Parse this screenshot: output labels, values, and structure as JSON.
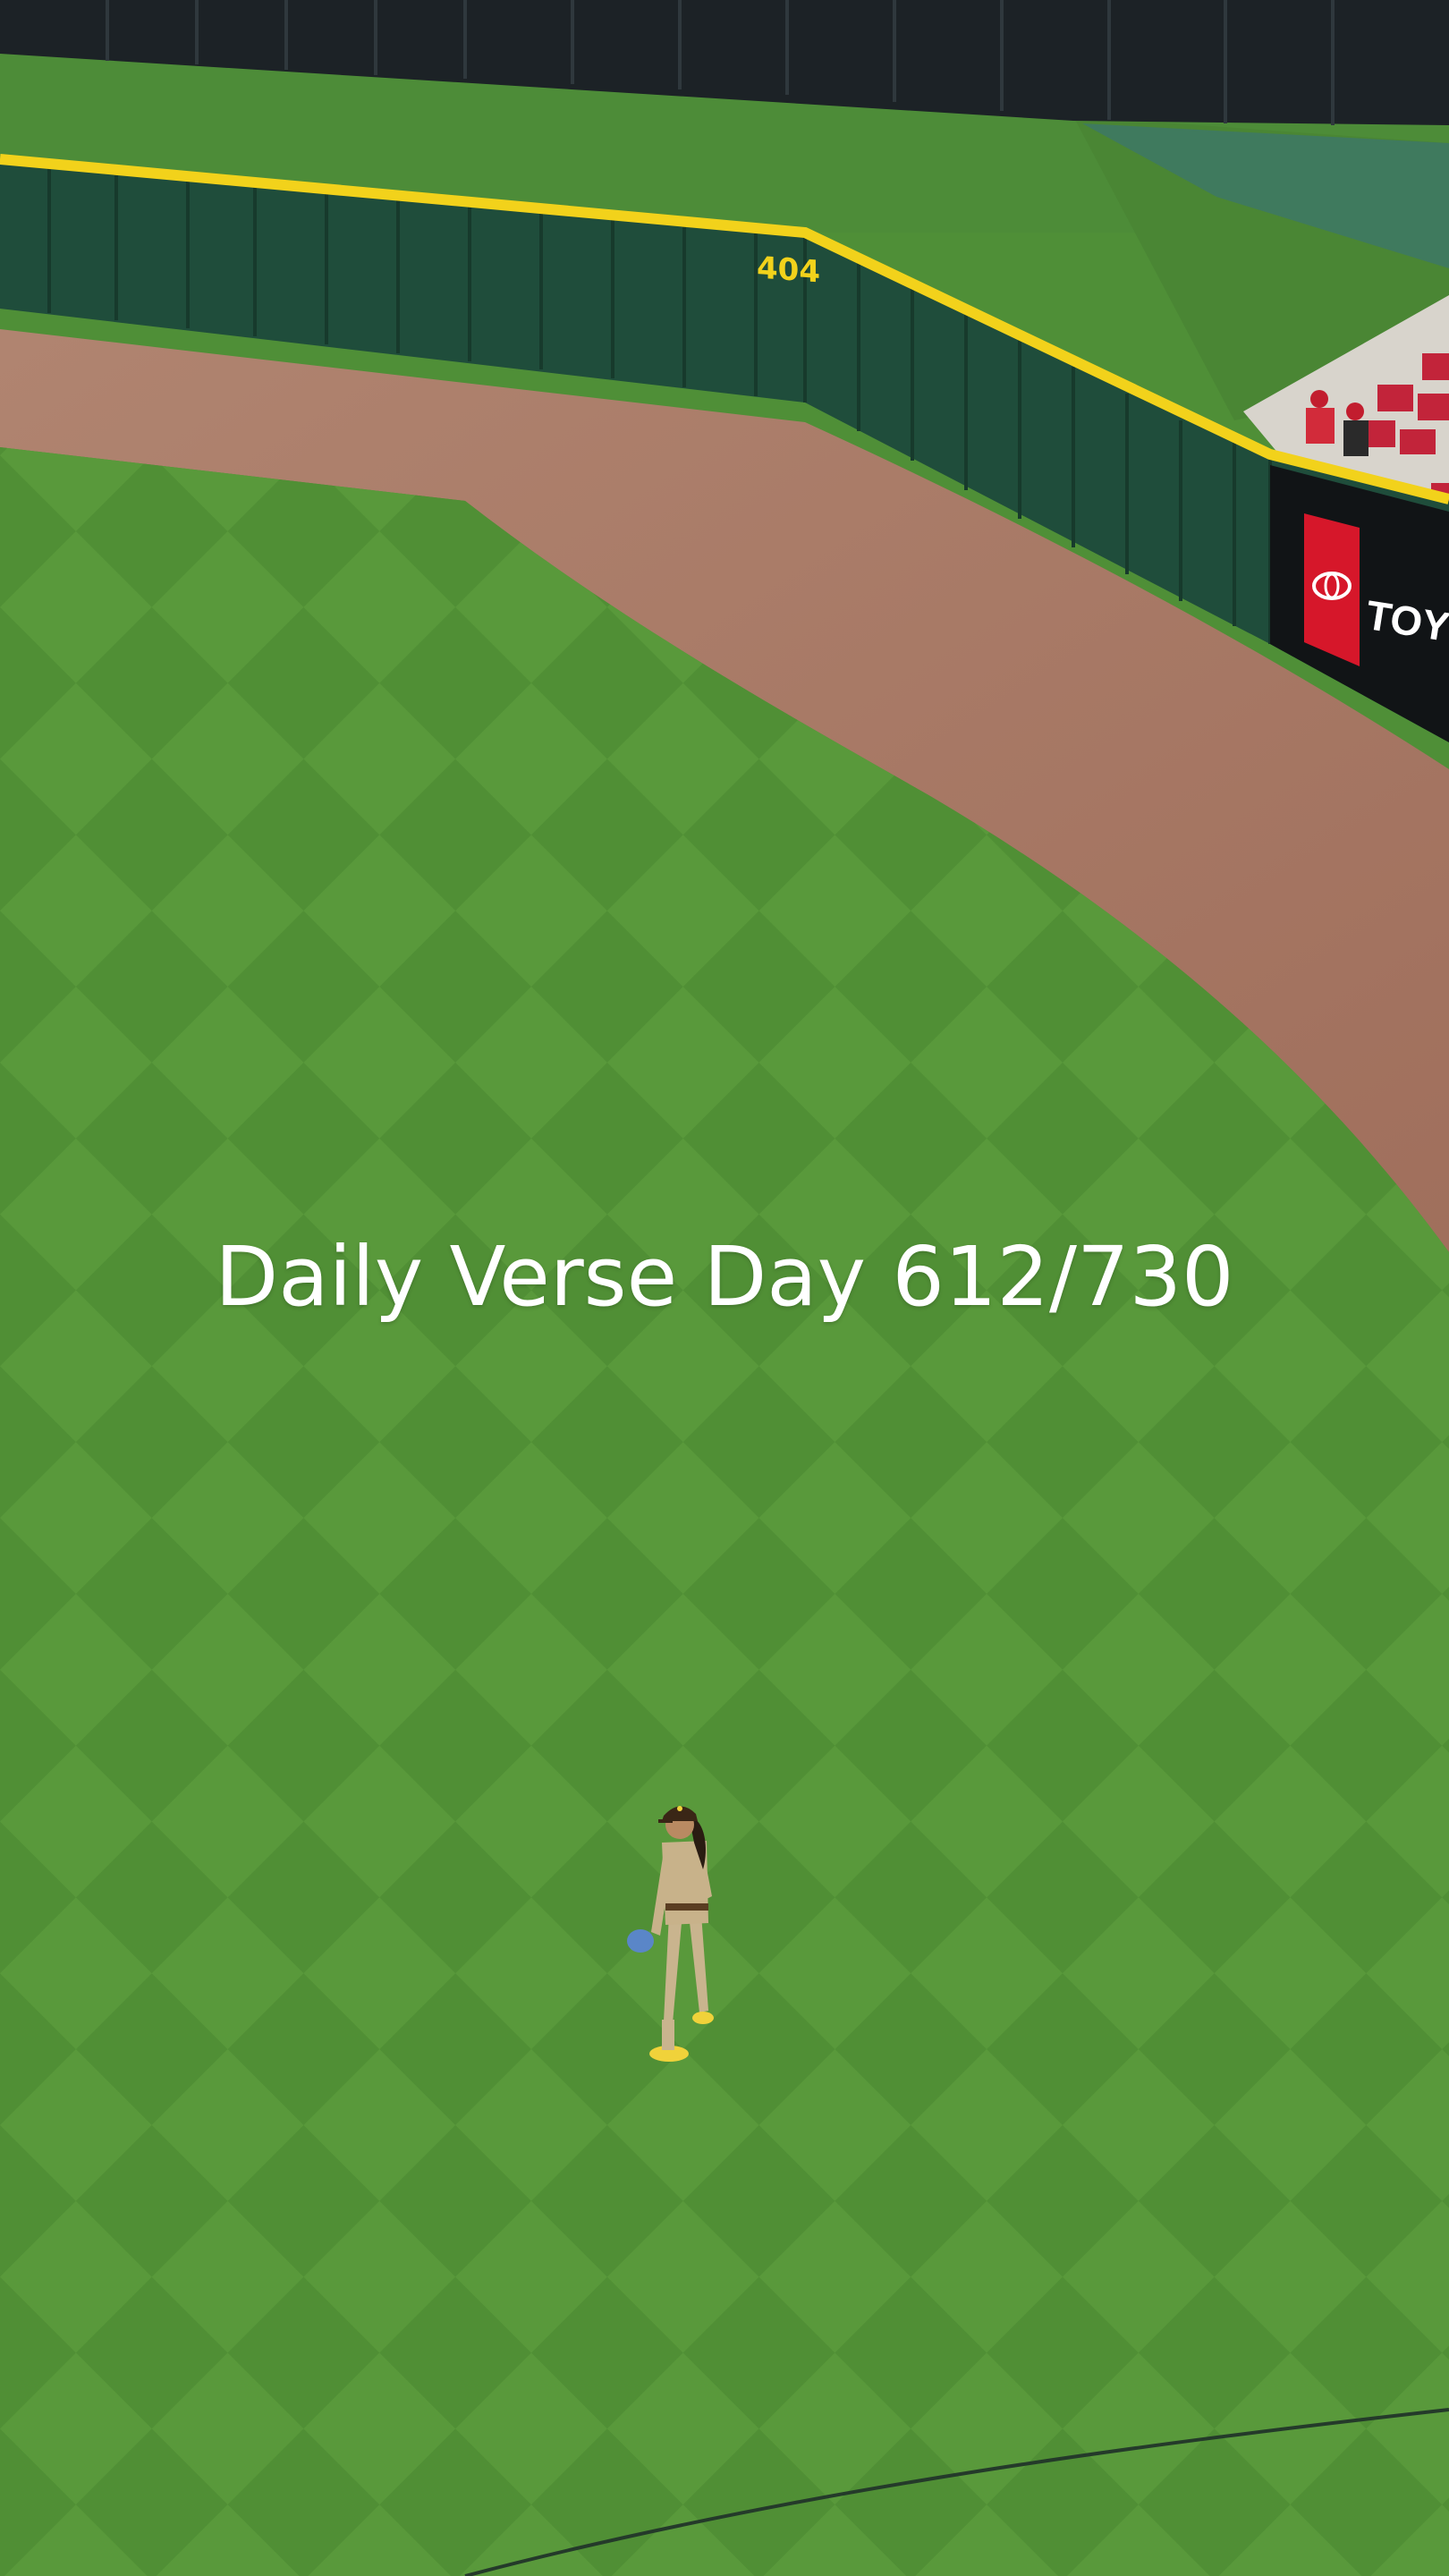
{
  "caption": {
    "text": "Daily Verse Day 612/730"
  },
  "outfield_wall": {
    "distance_marker": "404",
    "sponsor_text": "TOYO",
    "sponsor_logo": "toyota-logo"
  },
  "colors": {
    "grass_light": "#5a9a3c",
    "grass_dark": "#4a8a33",
    "warning_track": "#a97a66",
    "wall": "#1f4d3b",
    "wall_padding_top": "#f2d21b",
    "sponsor_red": "#d6172a",
    "caption": "#ffffff"
  }
}
